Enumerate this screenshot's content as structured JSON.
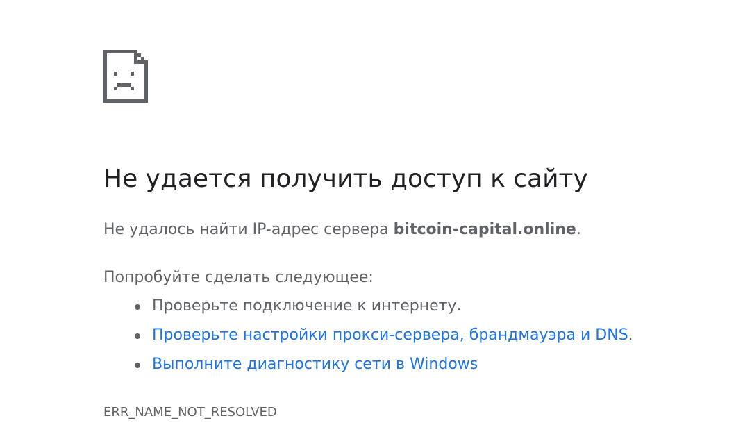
{
  "error": {
    "icon": "sad-document-icon",
    "headline": "Не удается получить доступ к сайту",
    "summary_prefix": "Не удалось найти IP-адрес сервера ",
    "host": "bitcoin-capital.online",
    "summary_suffix": ".",
    "suggestions_heading": "Попробуйте сделать следующее:",
    "suggestions": [
      {
        "text": "Проверьте подключение к интернету.",
        "is_link": false
      },
      {
        "text": "Проверьте настройки прокси-сервера, брандмауэра и DNS",
        "suffix": ".",
        "is_link": true
      },
      {
        "text": "Выполните диагностику сети в Windows",
        "is_link": true
      }
    ],
    "code": "ERR_NAME_NOT_RESOLVED"
  },
  "colors": {
    "heading": "#202124",
    "text": "#5f6368",
    "link": "#1a73e8",
    "background": "#ffffff"
  }
}
